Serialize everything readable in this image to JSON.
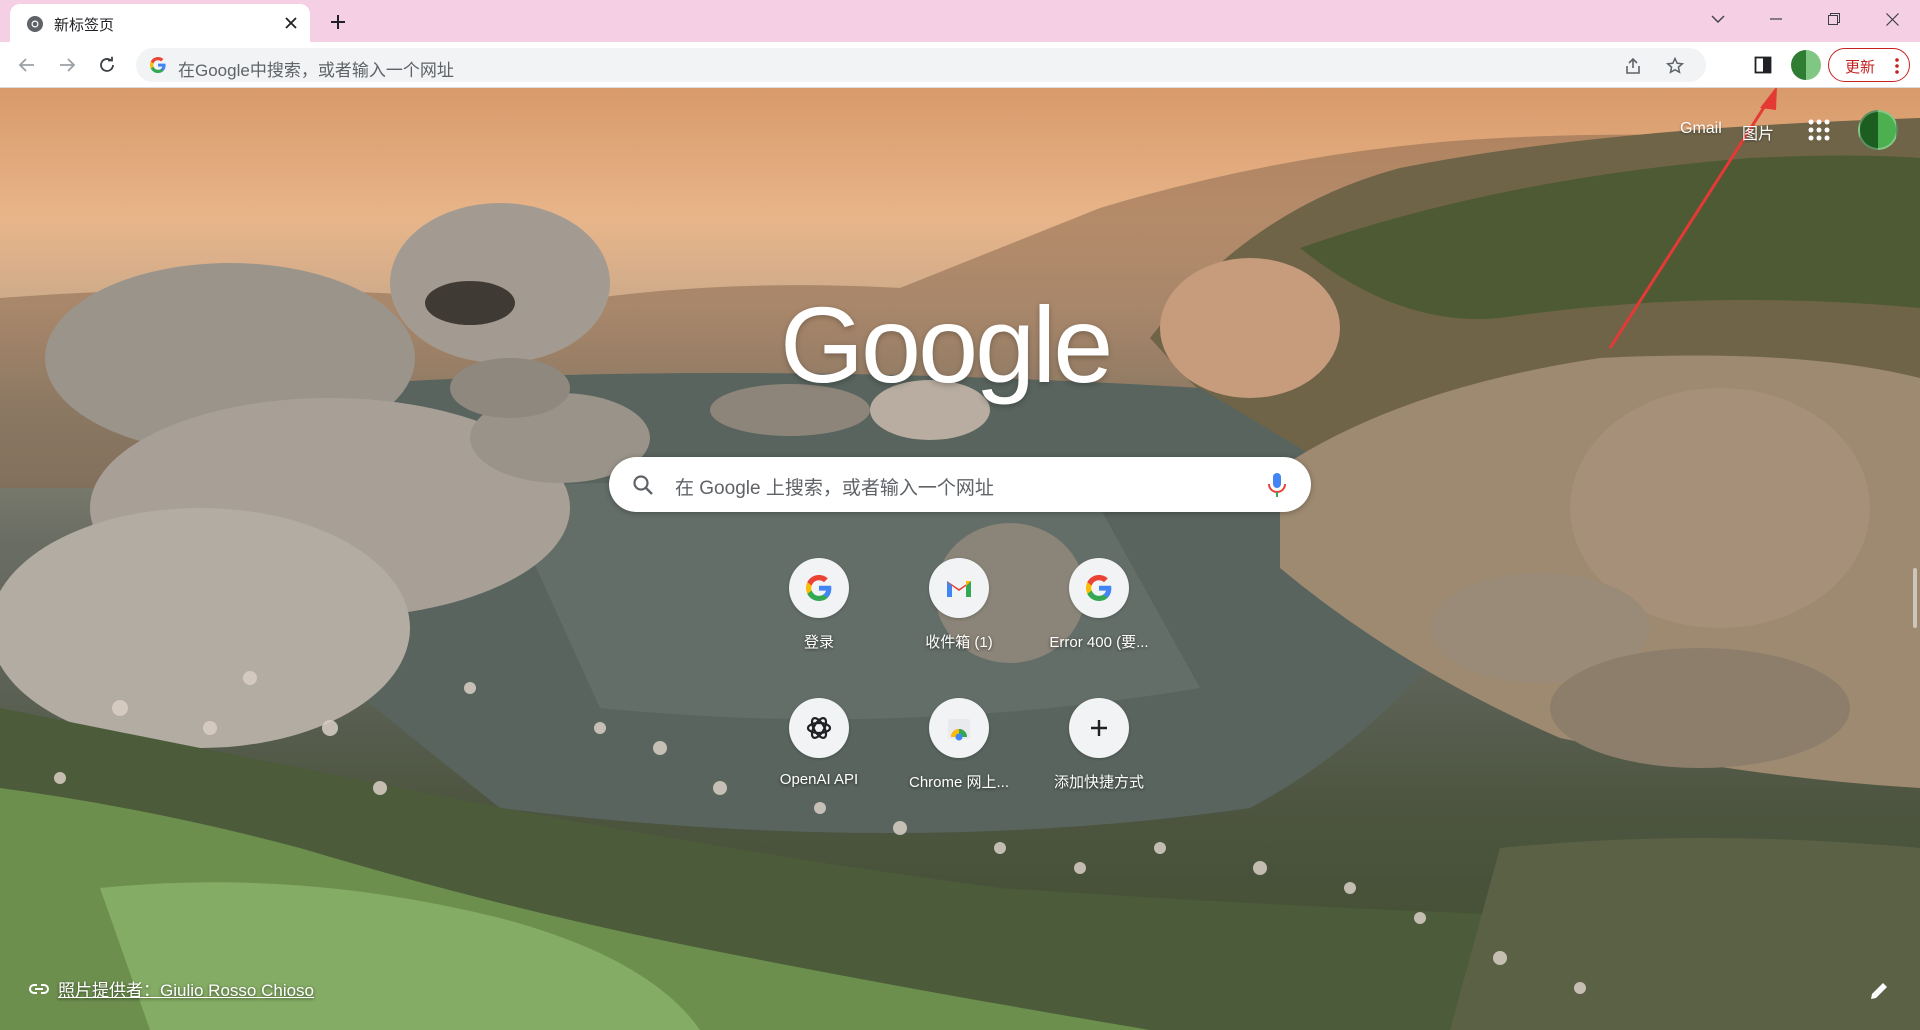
{
  "tab": {
    "title": "新标签页",
    "favicon": "chrome-icon"
  },
  "toolbar": {
    "omnibox_placeholder": "在Google中搜索，或者输入一个网址",
    "update_label": "更新"
  },
  "top_links": {
    "gmail": "Gmail",
    "images": "图片"
  },
  "logo": "Google",
  "search": {
    "placeholder": "在 Google 上搜索，或者输入一个网址"
  },
  "shortcuts": [
    {
      "label": "登录",
      "icon": "google-g-icon"
    },
    {
      "label": "收件箱 (1)",
      "icon": "gmail-icon"
    },
    {
      "label": "Error 400 (要...",
      "icon": "google-g-icon"
    },
    {
      "label": "OpenAI API",
      "icon": "openai-icon"
    },
    {
      "label": "Chrome 网上...",
      "icon": "chrome-web-store-icon"
    },
    {
      "label": "添加快捷方式",
      "icon": "plus-icon"
    }
  ],
  "attribution": {
    "text": "照片提供者：Giulio Rosso Chioso"
  },
  "colors": {
    "tabstrip": "#f5cfe3",
    "update": "#c5221f",
    "arrow": "#e53935"
  }
}
